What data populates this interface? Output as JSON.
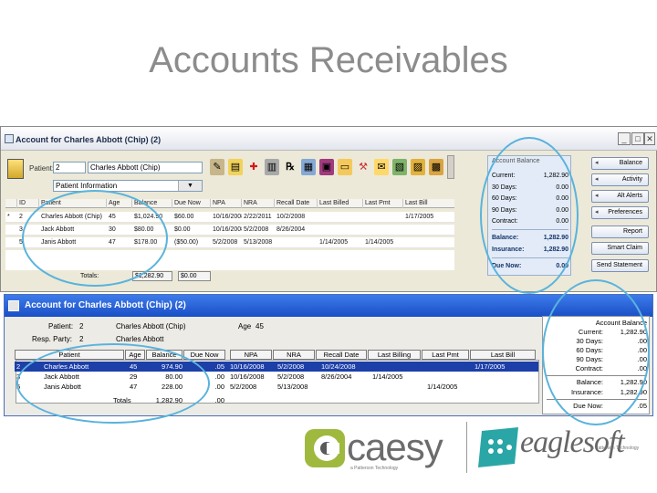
{
  "slide": {
    "title": "Accounts Receivables"
  },
  "win1": {
    "title": "Account for Charles Abbott (Chip) (2)",
    "patient_label": "Patient:",
    "patient_id": "2",
    "patient_name": "Charles Abbott (Chip)",
    "view_combo": "Patient Information",
    "columns": [
      "ID",
      "Patient",
      "Age",
      "Balance",
      "Due Now",
      "NPA",
      "NRA",
      "Recall Date",
      "Last Billed",
      "Last Pmt",
      "Last Bill"
    ],
    "rows": [
      {
        "mark": "*",
        "id": "2",
        "patient": "Charles Abbott (Chip)",
        "age": "45",
        "balance": "$1,024.90",
        "due": "$60.00",
        "npa": "10/16/2008",
        "nra": "2/22/2011",
        "recall": "10/2/2008",
        "last_billed": "",
        "last_pmt": "",
        "last_bill": "1/17/2005"
      },
      {
        "mark": "",
        "id": "3",
        "patient": "Jack Abbott",
        "age": "30",
        "balance": "$80.00",
        "due": "$0.00",
        "npa": "10/16/2008",
        "nra": "5/2/2008",
        "recall": "8/26/2004",
        "last_billed": "",
        "last_pmt": "",
        "last_bill": ""
      },
      {
        "mark": "",
        "id": "5",
        "patient": "Janis Abbott",
        "age": "47",
        "balance": "$178.00",
        "due": "($50.00)",
        "npa": "5/2/2008",
        "nra": "5/13/2008",
        "recall": "",
        "last_billed": "1/14/2005",
        "last_pmt": "1/14/2005",
        "last_bill": ""
      }
    ],
    "totals_label": "Totals:",
    "total_balance": "$1,282.90",
    "total_due": "$0.00",
    "balance_panel": {
      "title": "Account Balance",
      "rows": [
        {
          "k": "Current:",
          "v": "1,282.90"
        },
        {
          "k": "30 Days:",
          "v": "0.00"
        },
        {
          "k": "60 Days:",
          "v": "0.00"
        },
        {
          "k": "90 Days:",
          "v": "0.00"
        },
        {
          "k": "Contract:",
          "v": "0.00"
        }
      ],
      "balance_label": "Balance:",
      "balance_value": "1,282.90",
      "insurance_label": "Insurance:",
      "insurance_value": "1,282.90",
      "due_now_label": "Due Now:",
      "due_now_value": "0.00"
    },
    "buttons": [
      "Balance",
      "Activity",
      "Alt Alerts",
      "Preferences",
      "Report",
      "Smart Claim",
      "Send Statement"
    ]
  },
  "win2": {
    "title": "Account for Charles Abbott (Chip) (2)",
    "patient_label": "Patient:",
    "patient_id": "2",
    "patient_name": "Charles Abbott (Chip)",
    "age_label": "Age",
    "age_value": "45",
    "resp_label": "Resp. Party:",
    "resp_id": "2",
    "resp_name": "Charles Abbott",
    "columns": [
      "Patient",
      "Age",
      "Balance",
      "Due Now",
      "NPA",
      "NRA",
      "Recall Date",
      "Last Billing",
      "Last Pmt",
      "Last Bill"
    ],
    "rows": [
      {
        "id": "2",
        "patient": "Charles Abbott",
        "age": "45",
        "balance": "974.90",
        "due": ".05",
        "npa": "10/16/2008",
        "nra": "5/2/2008",
        "recall": "10/24/2008",
        "last_billing": "",
        "last_pmt": "",
        "last_bill": "1/17/2005"
      },
      {
        "id": "3",
        "patient": "Jack Abbott",
        "age": "29",
        "balance": "80.00",
        "due": ".00",
        "npa": "10/16/2008",
        "nra": "5/2/2008",
        "recall": "8/26/2004",
        "last_billing": "1/14/2005",
        "last_pmt": "",
        "last_bill": ""
      },
      {
        "id": "5",
        "patient": "Janis Abbott",
        "age": "47",
        "balance": "228.00",
        "due": ".00",
        "npa": "5/2/2008",
        "nra": "5/13/2008",
        "recall": "",
        "last_billing": "",
        "last_pmt": "1/14/2005",
        "last_bill": ""
      }
    ],
    "totals_label": "Totals",
    "total_balance": "1,282.90",
    "total_due": ".00",
    "balance_panel": {
      "title": "Account Balance",
      "rows": [
        {
          "k": "Current:",
          "v": "1,282.90"
        },
        {
          "k": "30 Days:",
          "v": ".00"
        },
        {
          "k": "60 Days:",
          "v": ".00"
        },
        {
          "k": "90 Days:",
          "v": ".00"
        },
        {
          "k": "Contract:",
          "v": ".00"
        }
      ],
      "balance_label": "Balance:",
      "balance_value": "1,282.90",
      "insurance_label": "Insurance:",
      "insurance_value": "1,282.90",
      "due_now_label": "Due Now:",
      "due_now_value": ".05"
    }
  },
  "logos": {
    "caesy": "caesy",
    "caesy_tagline": "a Patterson Technology",
    "eaglesoft": "eaglesoft",
    "eaglesoft_tagline": "a Patterson Technology"
  },
  "colors": {
    "highlight": "#59b3dc",
    "eaglesoft_titlebar": "#1a4fc6",
    "selected_row": "#1c3fa8"
  }
}
